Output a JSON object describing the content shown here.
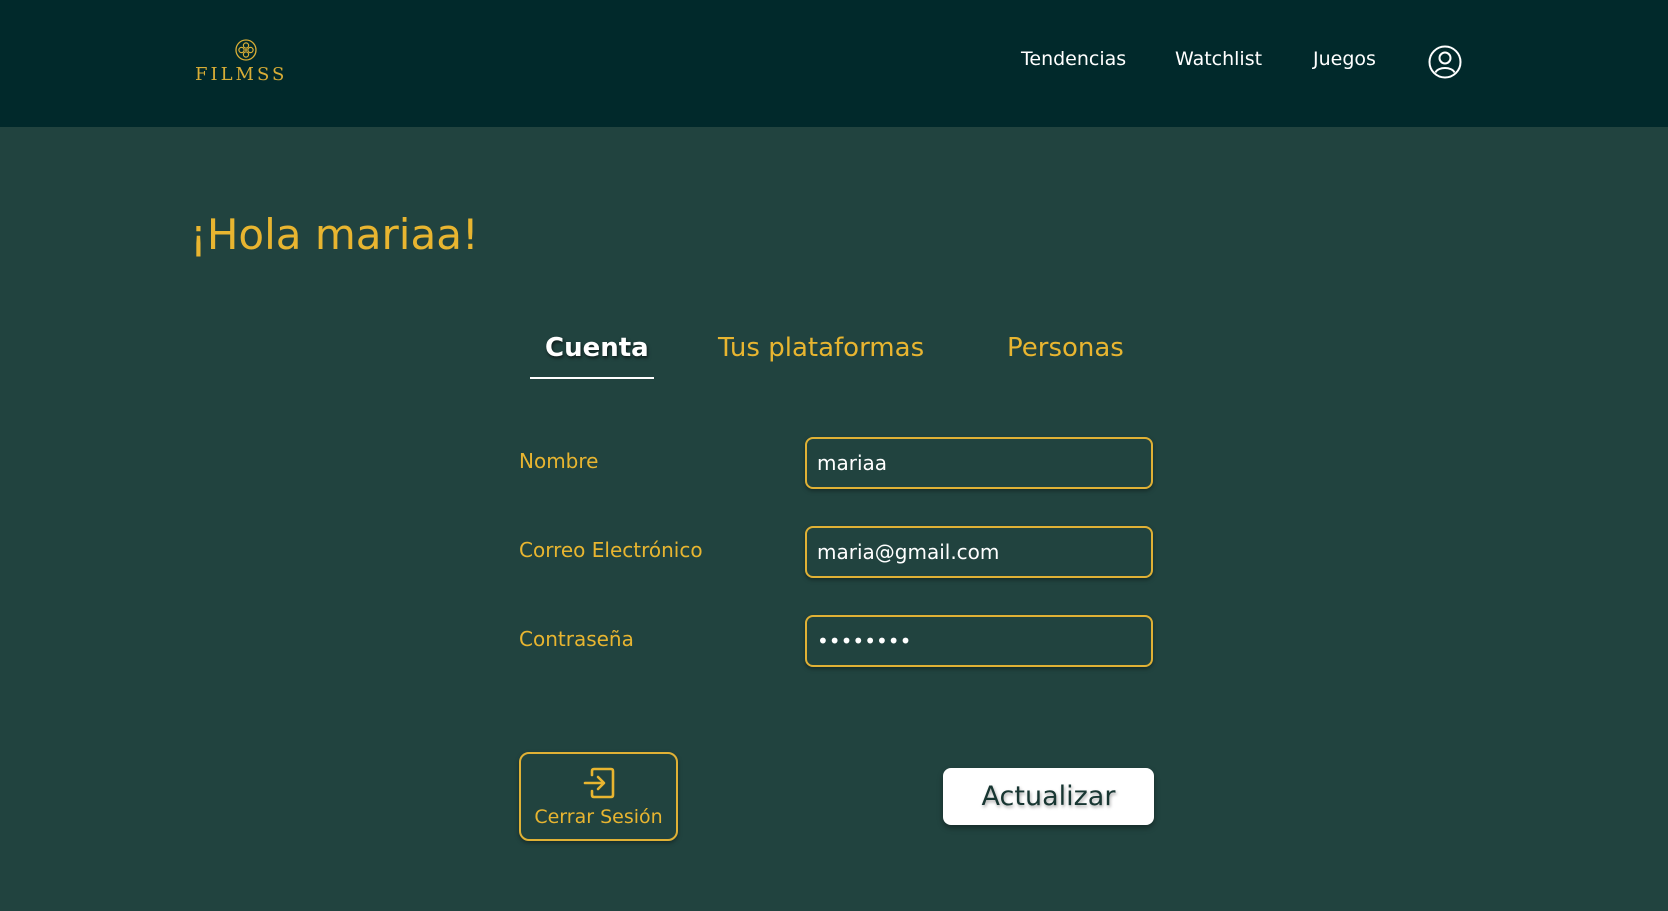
{
  "brand": {
    "name": "FILMSS"
  },
  "nav": {
    "links": [
      "Tendencias",
      "Watchlist",
      "Juegos"
    ],
    "profile_icon": "user-circle-icon"
  },
  "greeting": "¡Hola mariaa!",
  "tabs": [
    {
      "label": "Cuenta",
      "active": true
    },
    {
      "label": "Tus plataformas",
      "active": false
    },
    {
      "label": "Personas",
      "active": false
    }
  ],
  "form": {
    "name": {
      "label": "Nombre",
      "value": "mariaa"
    },
    "email": {
      "label": "Correo Electrónico",
      "value": "maria@gmail.com"
    },
    "password": {
      "label": "Contraseña",
      "value": "12345678"
    }
  },
  "actions": {
    "logout_label": "Cerrar Sesión",
    "logout_icon": "logout-icon",
    "update_label": "Actualizar"
  },
  "colors": {
    "header_bg": "#01292b",
    "page_bg": "#21433f",
    "accent": "#e8b530",
    "text_light": "#ffffff"
  }
}
